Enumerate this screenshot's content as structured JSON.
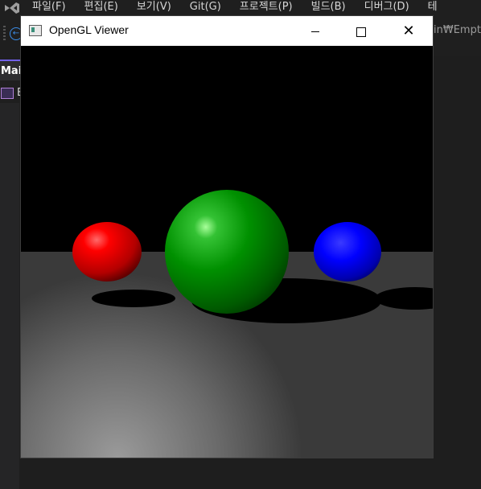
{
  "ide": {
    "menu": [
      "파일(F)",
      "편집(E)",
      "보기(V)",
      "Git(G)",
      "프로젝트(P)",
      "빌드(B)",
      "디버그(D)",
      "테"
    ],
    "path_text": "in₩Empty",
    "doc_tab": "Mai",
    "sub_tab": "E"
  },
  "window": {
    "title": "OpenGL Viewer",
    "icon": "app-window-icon",
    "controls": [
      "minimize-icon",
      "maximize-icon",
      "close-icon"
    ]
  },
  "scene": {
    "background": "#000000",
    "floor_color": "#3a3a3a",
    "spheres": [
      {
        "name": "red-sphere",
        "color": "#ff0000"
      },
      {
        "name": "green-sphere",
        "color": "#00a000"
      },
      {
        "name": "blue-sphere",
        "color": "#0000ff"
      }
    ]
  }
}
